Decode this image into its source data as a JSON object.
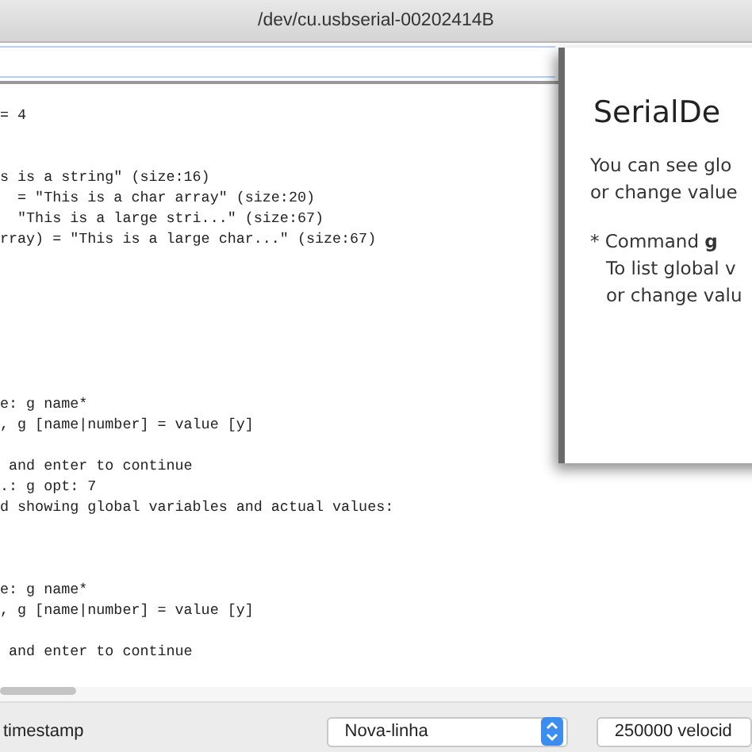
{
  "window": {
    "title": "/dev/cu.usbserial-00202414B"
  },
  "output_lines": [
    {
      "kind": "text",
      "text": "= 4"
    },
    {
      "kind": "blank"
    },
    {
      "kind": "blank"
    },
    {
      "kind": "text",
      "text": "s is a string\" (size:16)"
    },
    {
      "kind": "text",
      "text": "  = \"This is a char array\" (size:20)"
    },
    {
      "kind": "text",
      "text": "  \"This is a large stri...\" (size:67)"
    },
    {
      "kind": "text",
      "text": "rray) = \"This is a large char...\" (size:67)"
    },
    {
      "kind": "blank"
    },
    {
      "kind": "blank"
    },
    {
      "kind": "blank"
    },
    {
      "kind": "blank"
    },
    {
      "kind": "blank"
    },
    {
      "kind": "blank"
    },
    {
      "kind": "blank"
    },
    {
      "kind": "text",
      "text": "e: g name*"
    },
    {
      "kind": "text",
      "text": ", g [name|number] = value [y]"
    },
    {
      "kind": "blank"
    },
    {
      "kind": "text",
      "text": " and enter to continue"
    },
    {
      "kind": "text",
      "text": ".: g opt: 7"
    },
    {
      "kind": "text",
      "text": "d showing global variables and actual values:"
    },
    {
      "kind": "blank"
    },
    {
      "kind": "blank"
    },
    {
      "kind": "blank"
    },
    {
      "kind": "text",
      "text": "e: g name*"
    },
    {
      "kind": "text",
      "text": ", g [name|number] = value [y]"
    },
    {
      "kind": "blank"
    },
    {
      "kind": "text",
      "text": " and enter to continue"
    }
  ],
  "footer": {
    "timestamp_label": "timestamp",
    "line_ending": "Nova-linha",
    "baud_rate": "250000 velocid"
  },
  "slide": {
    "title": "SerialDe",
    "intro": [
      "You can see glo",
      "or change value"
    ],
    "bullet": "* Command **g**",
    "bullet_lines": [
      "To list global v",
      "or change valu"
    ]
  }
}
